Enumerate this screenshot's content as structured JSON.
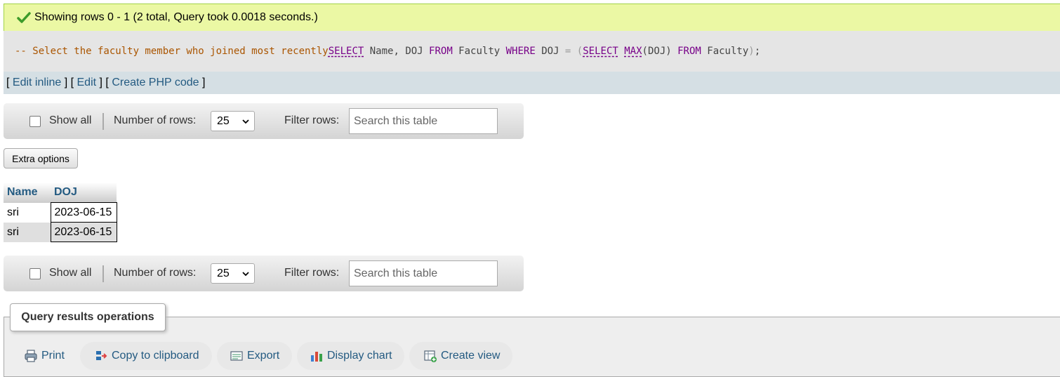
{
  "success": {
    "message": "Showing rows 0 - 1 (2 total, Query took 0.0018 seconds.)"
  },
  "sql": {
    "comment": "-- Select the faculty member who joined most recently",
    "kw_select": "SELECT",
    "cols": " Name, DOJ ",
    "kw_from": "FROM",
    "table": " Faculty ",
    "kw_where": "WHERE",
    "doj": " DOJ ",
    "eq": "=",
    "space": " ",
    "lparen": "(",
    "kw_select2": "SELECT",
    "space2": " ",
    "fn_max": "MAX",
    "max_arg": "(DOJ) ",
    "kw_from2": "FROM",
    "table2": " Faculty",
    "rparen": ")",
    "end": ";"
  },
  "edit_links": {
    "open1": "[ ",
    "edit_inline": "Edit inline",
    "mid1": " ] [ ",
    "edit": "Edit",
    "mid2": " ] [ ",
    "create_php": "Create PHP code",
    "close": " ]"
  },
  "navigation": {
    "show_all": "Show all",
    "number_of_rows_label": "Number of rows:",
    "rows_value": "25",
    "filter_label": "Filter rows:",
    "search_placeholder": "Search this table"
  },
  "extra_options": "Extra options",
  "table": {
    "headers": [
      "Name",
      "DOJ"
    ],
    "rows": [
      [
        "sri",
        "2023-06-15"
      ],
      [
        "sri",
        "2023-06-15"
      ]
    ]
  },
  "operations": {
    "title": "Query results operations",
    "print": "Print",
    "copy": "Copy to clipboard",
    "export": "Export",
    "chart": "Display chart",
    "view": "Create view"
  },
  "colors": {
    "success_bg": "#ebf8a4",
    "link": "#235a81",
    "keyword": "#770088",
    "comment": "#aa5500"
  }
}
